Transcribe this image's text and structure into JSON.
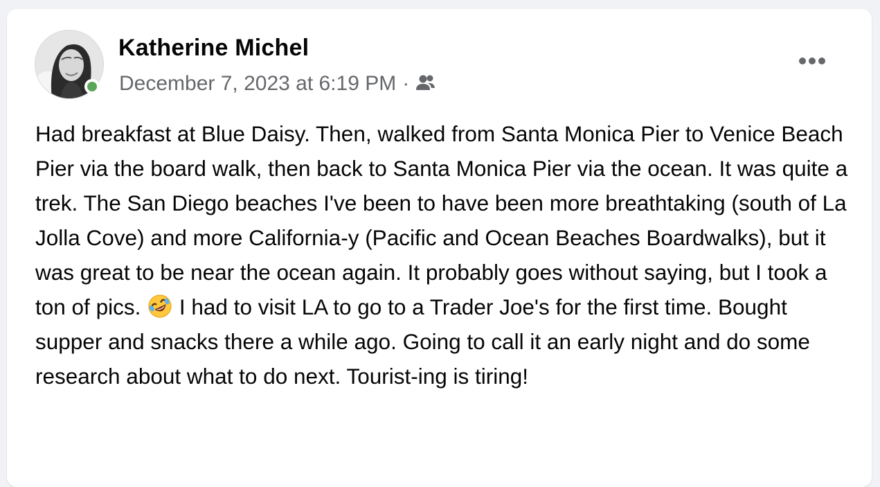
{
  "post": {
    "author_name": "Katherine Michel",
    "timestamp": "December 7, 2023 at 6:19 PM",
    "separator": "·",
    "audience_icon": "friends-icon",
    "more_icon": "more-options-icon",
    "online_status_color": "#5ba65b",
    "body_part_1": "Had breakfast at Blue Daisy. Then, walked from Santa Monica Pier to Venice Beach Pier via the board walk, then back to Santa Monica Pier via the ocean. It was quite a trek. The San Diego beaches I've been to have been more breathtaking (south of La Jolla Cove) and more California-y (Pacific and Ocean Beaches Boardwalks), but it was great to be near the ocean again. It probably goes without saying, but I took a ton of pics.",
    "emoji": "rolling-on-the-floor-laughing-emoji",
    "body_part_2": "I had to visit LA to go to a Trader Joe's for the first time. Bought supper and snacks there a while ago. Going to call it an early night and do some research about what to do next. Tourist-ing is tiring!"
  },
  "colors": {
    "background": "#f0f2f5",
    "card": "#ffffff",
    "primary_text": "#050505",
    "secondary_text": "#65676b"
  }
}
